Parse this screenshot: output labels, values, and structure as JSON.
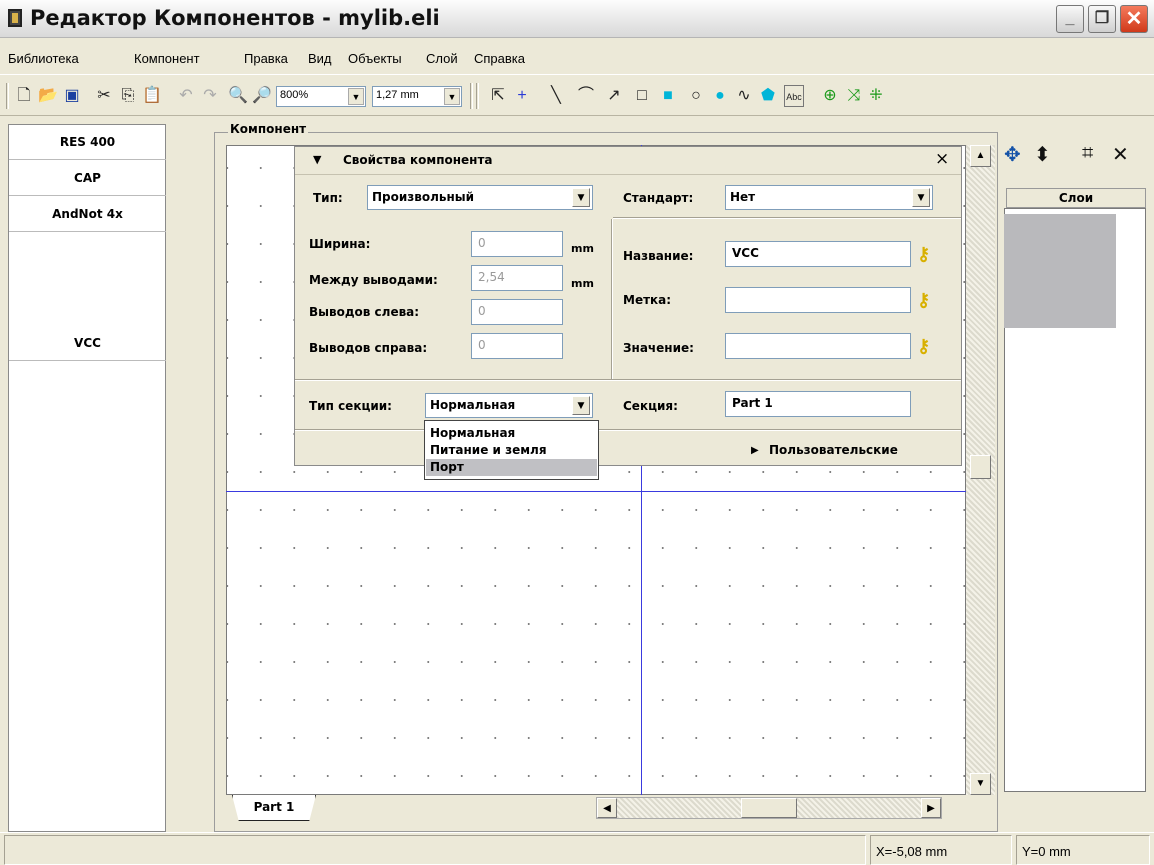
{
  "window": {
    "title": "Редактор Компонентов - mylib.eli",
    "min": "_",
    "max": "❐",
    "close": "✕"
  },
  "menu": [
    "Библиотека",
    "Компонент",
    "Правка",
    "Вид",
    "Объекты",
    "Слой",
    "Справка"
  ],
  "toolbar": {
    "zoom": "800%",
    "grid": "1,27 mm"
  },
  "components": [
    "RES 400",
    "CAP",
    "AndNot 4x",
    "VCC"
  ],
  "frame_label": "Компонент",
  "props": {
    "title": "Свойства компонента",
    "close": "×",
    "type_label": "Тип:",
    "type_value": "Произвольный",
    "standard_label": "Стандарт:",
    "standard_value": "Нет",
    "width_label": "Ширина:",
    "width_value": "0",
    "width_unit": "mm",
    "pitch_label": "Между выводами:",
    "pitch_value": "2,54",
    "pitch_unit": "mm",
    "left_pins_label": "Выводов слева:",
    "left_pins_value": "0",
    "right_pins_label": "Выводов справа:",
    "right_pins_value": "0",
    "name_label": "Название:",
    "name_value": "VCC",
    "mark_label": "Метка:",
    "mark_value": "",
    "value_label": "Значение:",
    "value_value": "",
    "section_type_label": "Тип секции:",
    "section_type_value": "Нормальная",
    "section_label": "Секция:",
    "section_value": "Part 1",
    "custom_label": "Пользовательские"
  },
  "section_options": [
    "Нормальная",
    "Питание и земля",
    "Порт"
  ],
  "tab": "Part 1",
  "layers_header": "Слои",
  "status": {
    "x": "X=-5,08 mm",
    "y": "Y=0 mm"
  }
}
